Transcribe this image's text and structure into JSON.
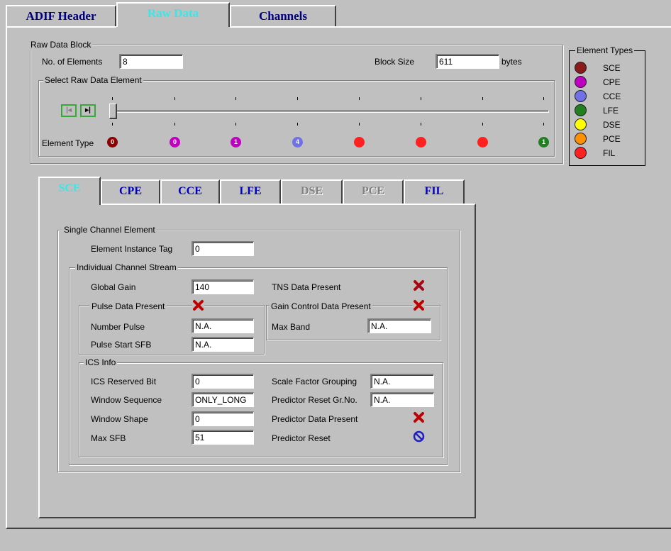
{
  "top_tabs": [
    {
      "label": "ADIF Header"
    },
    {
      "label": "Raw Data"
    },
    {
      "label": "Channels"
    }
  ],
  "raw_data_block": {
    "title": "Raw Data Block",
    "num_elements_label": "No. of Elements",
    "num_elements_value": "8",
    "block_size_label": "Block Size",
    "block_size_value": "611",
    "block_size_unit": "bytes"
  },
  "select_element": {
    "title": "Select Raw Data Element",
    "element_type_label": "Element Type",
    "slider_position": 0,
    "markers": [
      {
        "text": "0",
        "color": "#8b0000"
      },
      {
        "text": "0",
        "color": "#c000c0"
      },
      {
        "text": "1",
        "color": "#c000c0"
      },
      {
        "text": "4",
        "color": "#7070e8"
      },
      {
        "text": "",
        "color": "#ff2020"
      },
      {
        "text": "",
        "color": "#ff2020"
      },
      {
        "text": "",
        "color": "#ff2020"
      },
      {
        "text": "1",
        "color": "#208020"
      }
    ]
  },
  "element_types": {
    "title": "Element Types",
    "items": [
      {
        "label": "SCE",
        "color": "#8b1a1a"
      },
      {
        "label": "CPE",
        "color": "#c000c0"
      },
      {
        "label": "CCE",
        "color": "#7070e8"
      },
      {
        "label": "LFE",
        "color": "#208020"
      },
      {
        "label": "DSE",
        "color": "#ffff00"
      },
      {
        "label": "PCE",
        "color": "#ff9000"
      },
      {
        "label": "FIL",
        "color": "#ff2020"
      }
    ]
  },
  "inner_tabs": [
    {
      "label": "SCE"
    },
    {
      "label": "CPE"
    },
    {
      "label": "CCE"
    },
    {
      "label": "LFE"
    },
    {
      "label": "DSE"
    },
    {
      "label": "PCE"
    },
    {
      "label": "FIL"
    }
  ],
  "sce": {
    "title": "Single Channel Element",
    "instance_tag_label": "Element Instance Tag",
    "instance_tag_value": "0",
    "ics": {
      "title": "Individual Channel Stream",
      "global_gain_label": "Global Gain",
      "global_gain_value": "140",
      "tns_label": "TNS Data Present",
      "pulse_title": "Pulse Data Present",
      "number_pulse_label": "Number Pulse",
      "number_pulse_value": "N.A.",
      "pulse_start_label": "Pulse Start SFB",
      "pulse_start_value": "N.A.",
      "gain_title": "Gain Control Data Present",
      "max_band_label": "Max Band",
      "max_band_value": "N.A."
    },
    "ics_info": {
      "title": "ICS Info",
      "reserved_bit_label": "ICS Reserved Bit",
      "reserved_bit_value": "0",
      "window_sequence_label": "Window Sequence",
      "window_sequence_value": "ONLY_LONG",
      "window_shape_label": "Window Shape",
      "window_shape_value": "0",
      "max_sfb_label": "Max SFB",
      "max_sfb_value": "51",
      "sf_grouping_label": "Scale Factor Grouping",
      "sf_grouping_value": "N.A.",
      "predictor_reset_grno_label": "Predictor Reset Gr.No.",
      "predictor_reset_grno_value": "N.A.",
      "predictor_data_label": "Predictor Data Present",
      "predictor_reset_label": "Predictor Reset"
    }
  }
}
